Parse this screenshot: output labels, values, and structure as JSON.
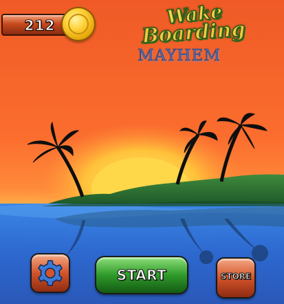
{
  "hud": {
    "coins": "212",
    "coin_icon": "gold-coin-icon"
  },
  "logo": {
    "line1": "Wake",
    "line2": "Boarding",
    "line3": "MAYHEM"
  },
  "buttons": {
    "settings_icon": "gear-icon",
    "start_label": "START",
    "store_label": "STORE"
  },
  "colors": {
    "sky_top": "#f0642a",
    "sky_mid": "#ff7a36",
    "sun": "#ffd84a",
    "island": "#2f7a3a",
    "sea": "#2e6fd0",
    "start_green": "#2f9a2a",
    "button_orange": "#d2542a"
  }
}
